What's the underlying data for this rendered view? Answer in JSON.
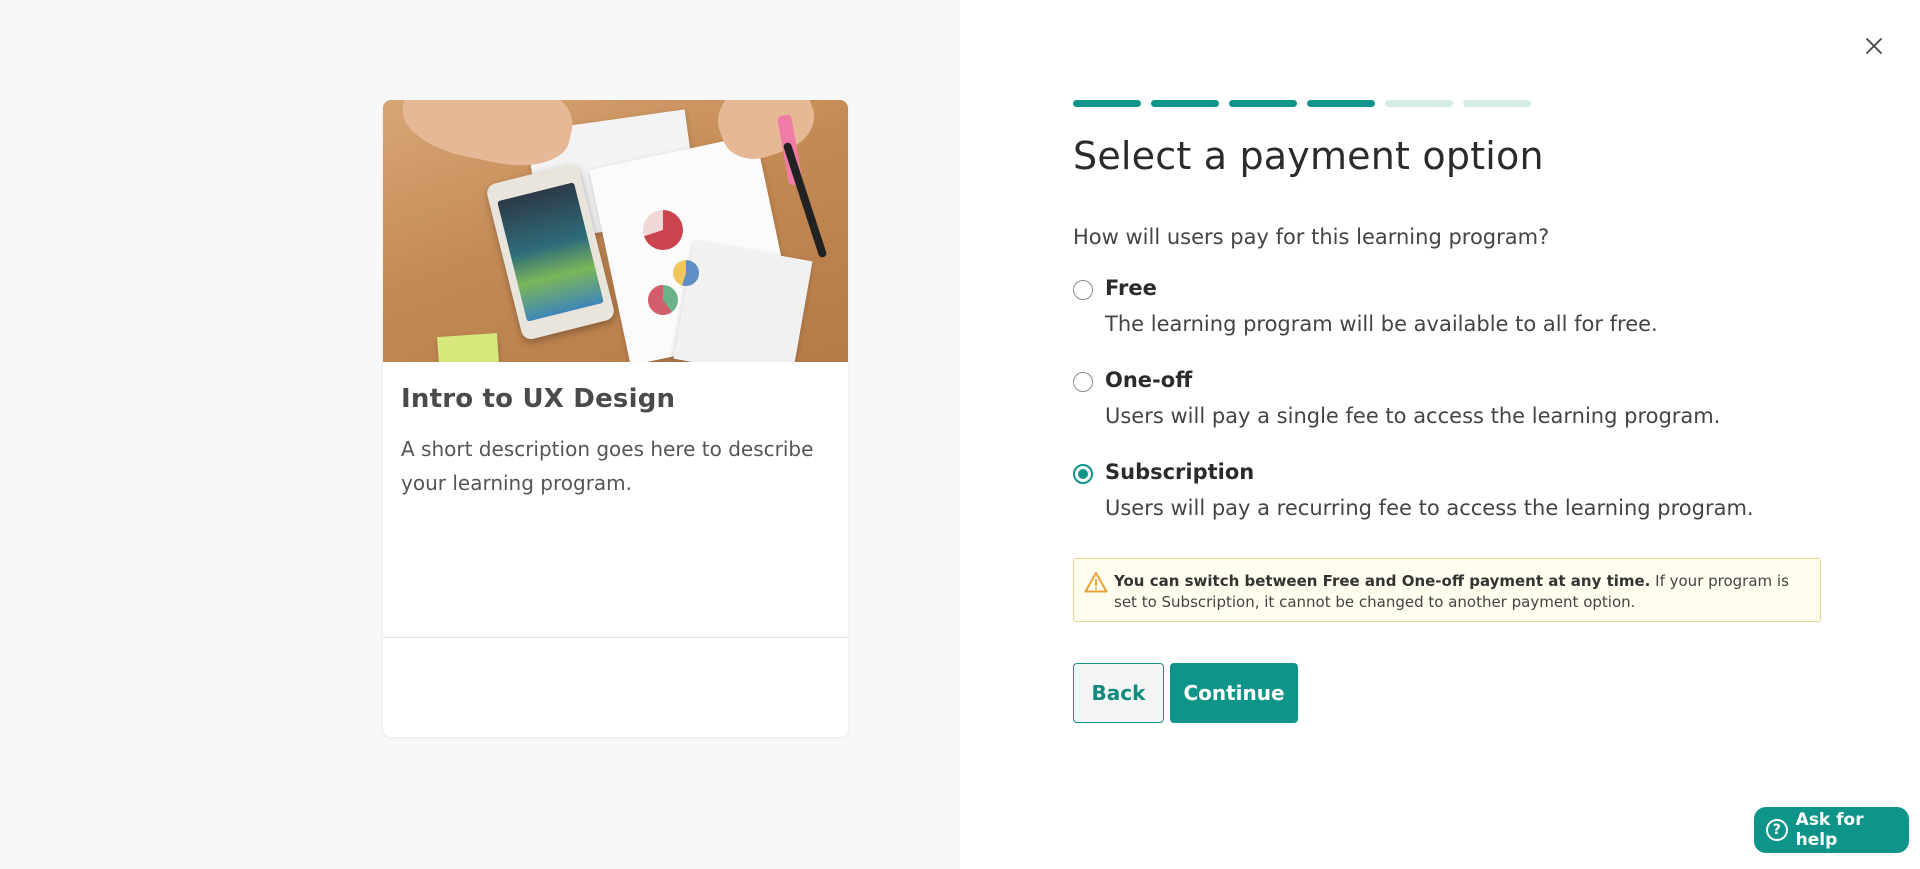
{
  "card": {
    "title": "Intro to UX Design",
    "description": "A short description goes here to describe your learning program.",
    "image_alt": "hands-holding-tablet-with-charts"
  },
  "wizard": {
    "steps_total": 6,
    "steps_completed": 4,
    "progress_active_color": "#0e9488",
    "progress_inactive_color": "#d5ece9",
    "title": "Select a payment option",
    "question": "How will users pay for this learning program?",
    "options": [
      {
        "label": "Free",
        "description": "The learning program will be available to all for free.",
        "selected": false
      },
      {
        "label": "One-off",
        "description": "Users will pay a single fee to access the learning program.",
        "selected": false
      },
      {
        "label": "Subscription",
        "description": "Users will pay a recurring fee to access the learning program.",
        "selected": true
      }
    ],
    "alert": {
      "bold": "You can switch between Free and One-off payment at any time.",
      "text": " If your program is set to Subscription, it cannot be changed to another payment option.",
      "icon": "warning-icon"
    },
    "back_label": "Back",
    "continue_label": "Continue"
  },
  "help": {
    "label": "Ask for help",
    "icon": "question-circle-icon"
  },
  "close_icon": "close-icon",
  "colors": {
    "accent": "#0e9488",
    "alert_bg": "#fffdee",
    "alert_border": "#e6d58a",
    "warning": "#e8a23a"
  }
}
